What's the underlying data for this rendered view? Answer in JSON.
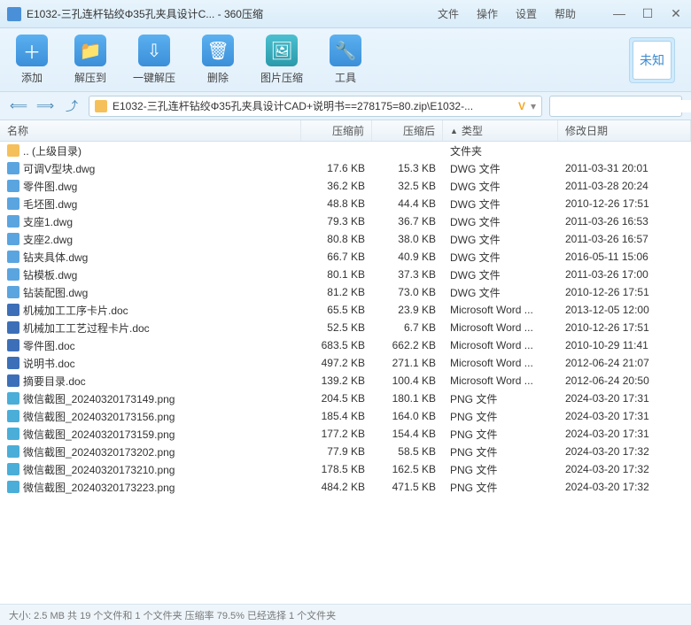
{
  "titlebar": {
    "title": "E1032-三孔连杆钻绞Φ35孔夹具设计C... - 360压缩",
    "menu": {
      "file": "文件",
      "operate": "操作",
      "settings": "设置",
      "help": "帮助"
    }
  },
  "toolbar": {
    "add": "添加",
    "extract": "解压到",
    "oneclick": "一键解压",
    "delete": "删除",
    "imgcompress": "图片压缩",
    "tools": "工具",
    "badge": "未知"
  },
  "path": {
    "text": "E1032-三孔连杆钻绞Φ35孔夹具设计CAD+说明书==278175=80.zip\\E1032-...",
    "vbadge": "V"
  },
  "columns": {
    "name": "名称",
    "before": "压缩前",
    "after": "压缩后",
    "type": "类型",
    "date": "修改日期",
    "sort": "▲"
  },
  "rows": [
    {
      "icon": "fc-folder",
      "name": ".. (上级目录)",
      "before": "",
      "after": "",
      "type": "文件夹",
      "date": ""
    },
    {
      "icon": "fc-dwg",
      "name": "可调V型块.dwg",
      "before": "17.6 KB",
      "after": "15.3 KB",
      "type": "DWG 文件",
      "date": "2011-03-31 20:01"
    },
    {
      "icon": "fc-dwg",
      "name": "零件图.dwg",
      "before": "36.2 KB",
      "after": "32.5 KB",
      "type": "DWG 文件",
      "date": "2011-03-28 20:24"
    },
    {
      "icon": "fc-dwg",
      "name": "毛坯图.dwg",
      "before": "48.8 KB",
      "after": "44.4 KB",
      "type": "DWG 文件",
      "date": "2010-12-26 17:51"
    },
    {
      "icon": "fc-dwg",
      "name": "支座1.dwg",
      "before": "79.3 KB",
      "after": "36.7 KB",
      "type": "DWG 文件",
      "date": "2011-03-26 16:53"
    },
    {
      "icon": "fc-dwg",
      "name": "支座2.dwg",
      "before": "80.8 KB",
      "after": "38.0 KB",
      "type": "DWG 文件",
      "date": "2011-03-26 16:57"
    },
    {
      "icon": "fc-dwg",
      "name": "钻夹具体.dwg",
      "before": "66.7 KB",
      "after": "40.9 KB",
      "type": "DWG 文件",
      "date": "2016-05-11 15:06"
    },
    {
      "icon": "fc-dwg",
      "name": "钻模板.dwg",
      "before": "80.1 KB",
      "after": "37.3 KB",
      "type": "DWG 文件",
      "date": "2011-03-26 17:00"
    },
    {
      "icon": "fc-dwg",
      "name": "钻装配图.dwg",
      "before": "81.2 KB",
      "after": "73.0 KB",
      "type": "DWG 文件",
      "date": "2010-12-26 17:51"
    },
    {
      "icon": "fc-doc",
      "name": "机械加工工序卡片.doc",
      "before": "65.5 KB",
      "after": "23.9 KB",
      "type": "Microsoft Word ...",
      "date": "2013-12-05 12:00"
    },
    {
      "icon": "fc-doc",
      "name": "机械加工工艺过程卡片.doc",
      "before": "52.5 KB",
      "after": "6.7 KB",
      "type": "Microsoft Word ...",
      "date": "2010-12-26 17:51"
    },
    {
      "icon": "fc-doc",
      "name": "零件图.doc",
      "before": "683.5 KB",
      "after": "662.2 KB",
      "type": "Microsoft Word ...",
      "date": "2010-10-29 11:41"
    },
    {
      "icon": "fc-doc",
      "name": "说明书.doc",
      "before": "497.2 KB",
      "after": "271.1 KB",
      "type": "Microsoft Word ...",
      "date": "2012-06-24 21:07"
    },
    {
      "icon": "fc-doc",
      "name": "摘要目录.doc",
      "before": "139.2 KB",
      "after": "100.4 KB",
      "type": "Microsoft Word ...",
      "date": "2012-06-24 20:50"
    },
    {
      "icon": "fc-png",
      "name": "微信截图_20240320173149.png",
      "before": "204.5 KB",
      "after": "180.1 KB",
      "type": "PNG 文件",
      "date": "2024-03-20 17:31"
    },
    {
      "icon": "fc-png",
      "name": "微信截图_20240320173156.png",
      "before": "185.4 KB",
      "after": "164.0 KB",
      "type": "PNG 文件",
      "date": "2024-03-20 17:31"
    },
    {
      "icon": "fc-png",
      "name": "微信截图_20240320173159.png",
      "before": "177.2 KB",
      "after": "154.4 KB",
      "type": "PNG 文件",
      "date": "2024-03-20 17:31"
    },
    {
      "icon": "fc-png",
      "name": "微信截图_20240320173202.png",
      "before": "77.9 KB",
      "after": "58.5 KB",
      "type": "PNG 文件",
      "date": "2024-03-20 17:32"
    },
    {
      "icon": "fc-png",
      "name": "微信截图_20240320173210.png",
      "before": "178.5 KB",
      "after": "162.5 KB",
      "type": "PNG 文件",
      "date": "2024-03-20 17:32"
    },
    {
      "icon": "fc-png",
      "name": "微信截图_20240320173223.png",
      "before": "484.2 KB",
      "after": "471.5 KB",
      "type": "PNG 文件",
      "date": "2024-03-20 17:32"
    }
  ],
  "status": "大小: 2.5 MB 共 19 个文件和 1 个文件夹 压缩率 79.5% 已经选择 1 个文件夹"
}
